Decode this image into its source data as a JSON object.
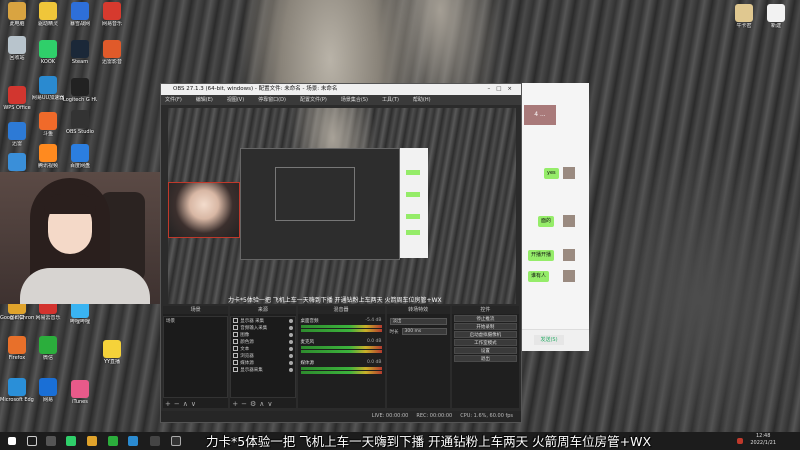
{
  "desktop": {
    "icons_left": [
      {
        "label": "此电脑",
        "color": "#d9a441"
      },
      {
        "label": "回收站",
        "color": "#b8c4cc"
      },
      {
        "label": "WPS Office",
        "color": "#d2362f"
      },
      {
        "label": "迅雷",
        "color": "#2d7ad6"
      },
      {
        "label": "控制面板",
        "color": "#3a8fd9"
      },
      {
        "label": "向日葵",
        "color": "#2f7fe0"
      },
      {
        "label": "Google Chrome",
        "color": "#e0a32b"
      },
      {
        "label": "Firefox",
        "color": "#e8702a"
      },
      {
        "label": "Microsoft Edge",
        "color": "#2a8fd8"
      }
    ],
    "icons_col2": [
      {
        "label": "驱动精灵",
        "color": "#f0c63a"
      },
      {
        "label": "KOOK",
        "color": "#2fcf6a"
      },
      {
        "label": "网易UU加速器",
        "color": "#2a8ad0"
      },
      {
        "label": "斗鱼",
        "color": "#f06a2a"
      },
      {
        "label": "腾讯视频",
        "color": "#ff8a1f"
      },
      {
        "label": "网易云音乐",
        "color": "#d3332e"
      },
      {
        "label": "微信",
        "color": "#2bae3c"
      },
      {
        "label": "网易",
        "color": "#1a6fd6"
      }
    ],
    "icons_col3": [
      {
        "label": "暴雪战网",
        "color": "#2e6fd9"
      },
      {
        "label": "Steam",
        "color": "#1b2838"
      },
      {
        "label": "Logitech G HUB",
        "color": "#222"
      },
      {
        "label": "OBS Studio",
        "color": "#333"
      },
      {
        "label": "百度网盘",
        "color": "#2b7ee0"
      },
      {
        "label": "哔哩哔哩",
        "color": "#3ab4f2"
      },
      {
        "label": "iTunes",
        "color": "#e85a8a"
      }
    ],
    "icons_col4": [
      {
        "label": "网易音乐",
        "color": "#d63a2e"
      },
      {
        "label": "迅雷影音",
        "color": "#e05a2a"
      },
      {
        "label": "YY直播",
        "color": "#f5d23a"
      }
    ],
    "icons_right": [
      {
        "label": "牛卡密",
        "color": "#e0c890"
      },
      {
        "label": "新建",
        "color": "#f2f2f2"
      }
    ]
  },
  "obs": {
    "title": "OBS 27.1.3 (64-bit, windows) - 配置文件: 未命名 - 场景: 未命名",
    "menu": [
      "文件(F)",
      "编辑(E)",
      "视图(V)",
      "停靠窗口(D)",
      "配置文件(P)",
      "场景集合(S)",
      "工具(T)",
      "帮助(H)"
    ],
    "preview_caption": "力卡*5体验一把 飞机上车一天嗨到下播 开通钻粉上车两天 火箭周车位房管+WX",
    "docks": {
      "scenes": {
        "header": "场景",
        "items": [
          "场景"
        ]
      },
      "sources": {
        "header": "来源",
        "items": [
          "显示器 采集",
          "音频输入采集",
          "图像",
          "颜色源",
          "文本",
          "浏览器",
          "媒体源",
          "显示器采集"
        ]
      },
      "mixer": {
        "header": "混音器",
        "rows": [
          {
            "name": "桌面音频",
            "db": "-5.4 dB"
          },
          {
            "name": "麦克风",
            "db": "0.0 dB"
          },
          {
            "name": "媒体源",
            "db": "0.0 dB"
          }
        ]
      },
      "transitions": {
        "header": "转场特效",
        "type": "淡出",
        "duration_label": "时长",
        "duration": "300 ms"
      },
      "controls": {
        "header": "控件",
        "buttons": [
          "停止推流",
          "开始录制",
          "启动虚拟摄像机",
          "工作室模式",
          "设置",
          "退出"
        ]
      }
    },
    "status": {
      "live": "LIVE: 00:00:00",
      "rec": "REC: 00:00:00",
      "cpu": "CPU: 1.6%, 60.00 fps"
    }
  },
  "chat": {
    "badge": "4 ...",
    "messages": [
      "yes",
      "面的",
      "开播开播",
      "谁有人"
    ],
    "send_label": "发送(S)"
  },
  "subtitle": "力卡*5体验一把 飞机上车一天嗨到下播 开通钻粉上车两天 火箭周车位房管+WX",
  "taskbar": {
    "time": "12:48",
    "date": "2022/1/21"
  }
}
